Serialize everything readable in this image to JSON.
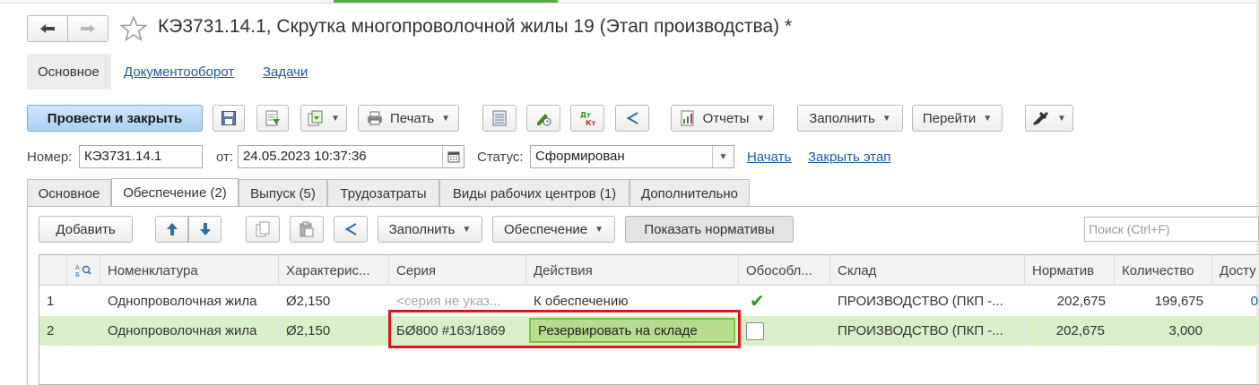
{
  "window": {
    "title": "КЭ3731.14.1, Скрутка многопроволочной жилы 19 (Этап производства) *"
  },
  "section_tabs": [
    "Основное",
    "Документооборот",
    "Задачи"
  ],
  "toolbar": {
    "post_close": "Провести и закрыть",
    "print": "Печать",
    "reports": "Отчеты",
    "fill": "Заполнить",
    "goto": "Перейти"
  },
  "header_fields": {
    "number_label": "Номер:",
    "number_value": "КЭ3731.14.1",
    "date_label": "от:",
    "date_value": "24.05.2023 10:37:36",
    "status_label": "Статус:",
    "status_value": "Сформирован",
    "start_link": "Начать",
    "close_stage_link": "Закрыть этап"
  },
  "form_tabs": [
    "Основное",
    "Обеспечение (2)",
    "Выпуск (5)",
    "Трудозатраты",
    "Виды рабочих центров (1)",
    "Дополнительно"
  ],
  "tab_toolbar": {
    "add": "Добавить",
    "fill": "Заполнить",
    "provision": "Обеспечение",
    "show_norms": "Показать нормативы",
    "search_placeholder": "Поиск (Ctrl+F)"
  },
  "table": {
    "columns": [
      "Номенклатура",
      "Характерис...",
      "Серия",
      "Действия",
      "Обособл...",
      "Склад",
      "Норматив",
      "Количество",
      "Досту"
    ],
    "rows": [
      {
        "n": "1",
        "nomenclature": "Однопроволочная жила",
        "characteristic": "Ø2,150",
        "series": "<серия не указ...",
        "action": "К обеспечению",
        "separate": "✔",
        "warehouse": "ПРОИЗВОДСТВО (ПКП -...",
        "norm": "202,675",
        "quantity": "199,675",
        "available": "0"
      },
      {
        "n": "2",
        "nomenclature": "Однопроволочная жила",
        "characteristic": "Ø2,150",
        "series": "БØ800 #163/1869",
        "action": "Резервировать на складе",
        "separate": "",
        "warehouse": "ПРОИЗВОДСТВО (ПКП -...",
        "norm": "202,675",
        "quantity": "3,000",
        "available": ""
      }
    ]
  },
  "colors": {
    "selected_row": "#d9efc7",
    "edit_cell": "#b6dc8f",
    "highlight": "#e0161f",
    "link": "#1f5aa6",
    "primary_button": "#a9d0f0",
    "checkmark": "#3a9a1a"
  }
}
